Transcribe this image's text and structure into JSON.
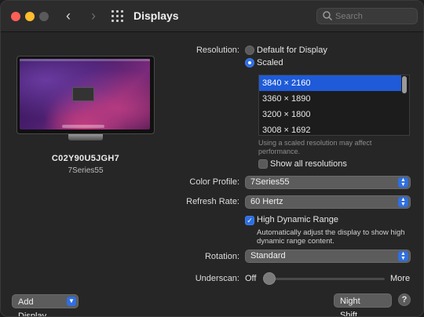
{
  "window": {
    "title": "Displays"
  },
  "toolbar": {
    "search_placeholder": "Search"
  },
  "display": {
    "name": "C02Y90U5JGH7",
    "model": "7Series55"
  },
  "buttons": {
    "add_display": "Add Display",
    "night_shift": "Night Shift…",
    "help": "?"
  },
  "resolution": {
    "label": "Resolution:",
    "default_option": "Default for Display",
    "scaled_option": "Scaled",
    "selected_mode": "Scaled",
    "list": [
      "3840 × 2160",
      "3360 × 1890",
      "3200 × 1800",
      "3008 × 1692"
    ],
    "selected_index": 0,
    "note_line1": "Using a scaled resolution may affect",
    "note_line2": "performance.",
    "show_all_label": "Show all resolutions",
    "show_all_checked": false
  },
  "color_profile": {
    "label": "Color Profile:",
    "value": "7Series55"
  },
  "refresh_rate": {
    "label": "Refresh Rate:",
    "value": "60 Hertz"
  },
  "hdr": {
    "label": "High Dynamic Range",
    "checked": true,
    "desc_line1": "Automatically adjust the display to show high",
    "desc_line2": "dynamic range content."
  },
  "rotation": {
    "label": "Rotation:",
    "value": "Standard"
  },
  "underscan": {
    "label": "Underscan:",
    "min_label": "Off",
    "max_label": "More",
    "level": 0
  },
  "colors": {
    "accent": "#2f6fe0",
    "selection": "#1f5bd8",
    "background": "#262626"
  }
}
